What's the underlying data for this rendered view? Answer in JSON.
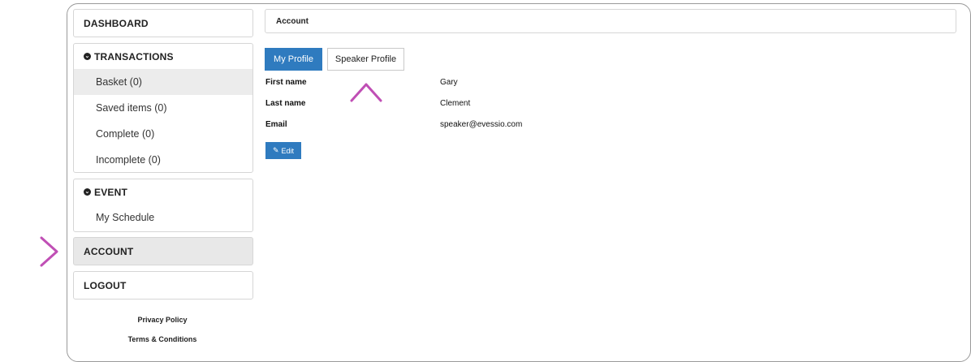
{
  "sidebar": {
    "dashboard": "DASHBOARD",
    "transactions": {
      "heading": "TRANSACTIONS",
      "items": [
        "Basket (0)",
        "Saved items (0)",
        "Complete (0)",
        "Incomplete (0)"
      ]
    },
    "event": {
      "heading": "EVENT",
      "items": [
        "My Schedule"
      ]
    },
    "account": "ACCOUNT",
    "logout": "LOGOUT",
    "footer": {
      "privacy": "Privacy Policy",
      "terms": "Terms & Conditions"
    }
  },
  "main": {
    "section_title": "Account",
    "tabs": [
      {
        "label": "My Profile",
        "active": true
      },
      {
        "label": "Speaker Profile",
        "active": false
      }
    ],
    "profile": {
      "fields": [
        {
          "label": "First name",
          "value": "Gary"
        },
        {
          "label": "Last name",
          "value": "Clement"
        },
        {
          "label": "Email",
          "value": "speaker@evessio.com"
        }
      ],
      "edit_label": "Edit"
    }
  },
  "colors": {
    "primary": "#2f7bbf",
    "active_row": "#ececec",
    "arrow_start": "#f4a04a",
    "arrow_end": "#c04fb5"
  },
  "icons": {
    "section_toggle": "chevron-circle-down-icon",
    "edit": "pencil-icon"
  }
}
